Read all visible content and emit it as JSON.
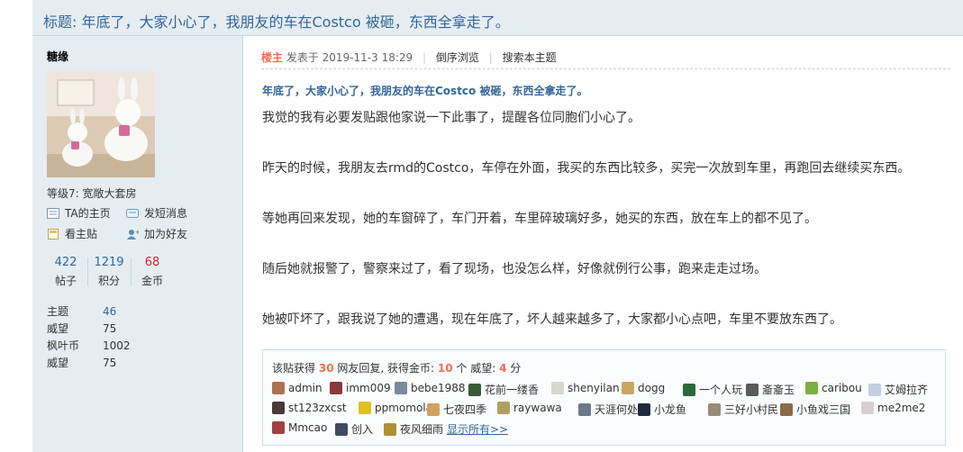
{
  "thread": {
    "title": "标题: 年底了，大家小心了，我朋友的车在Costco 被砸，东西全拿走了。"
  },
  "author": {
    "name": "糖缘",
    "level": "等级7: 宽敞大套房",
    "actions": {
      "profile": "TA的主页",
      "message": "发短消息",
      "view_only": "看主贴",
      "add_friend": "加为好友"
    },
    "stats": [
      {
        "value": "422",
        "label": "帖子",
        "color": "#336699"
      },
      {
        "value": "1219",
        "label": "积分",
        "color": "#336699"
      },
      {
        "value": "68",
        "label": "金币",
        "color": "#e02020"
      }
    ],
    "info": [
      {
        "key": "主题",
        "value": "46"
      },
      {
        "key": "威望",
        "value": "75"
      },
      {
        "key": "枫叶币",
        "value": "1002"
      },
      {
        "key": "威望",
        "value": "75"
      }
    ]
  },
  "post": {
    "op_label": "楼主",
    "posted_at": "发表于 2019-11-3 18:29",
    "reverse_order": "倒序浏览",
    "search_topic": "搜索本主题",
    "subject": "年底了，大家小心了，我朋友的车在Costco 被砸，东西全拿走了。",
    "paragraphs": [
      "我觉的我有必要发贴跟他家说一下此事了，提醒各位同胞们小心了。",
      "昨天的时候，我朋友去rmd的Costco，车停在外面，我买的东西比较多，买完一次放到车里，再跑回去继续买东西。",
      "等她再回来发现，她的车窗碎了，车门开着，车里碎玻璃好多，她买的东西，放在车上的都不见了。",
      "随后她就报警了，警察来过了，看了现场，也没怎么样，好像就例行公事，跑来走走过场。",
      "她被吓坏了，跟我说了她的遭遇，现在年底了，坏人越来越多了，大家都小心点吧，车里不要放东西了。"
    ]
  },
  "rating": {
    "prefix": "该贴获得",
    "replies": "30",
    "replies_suffix": "网友回复, 获得金币:",
    "coins": "10",
    "coins_suffix": "个 威望:",
    "prestige": "4",
    "prestige_suffix": "分",
    "users": [
      {
        "name": "admin",
        "color": "#b07050"
      },
      {
        "name": "imm009",
        "color": "#8a3a3a"
      },
      {
        "name": "bebe1988",
        "color": "#7a8a9a"
      },
      {
        "name": "花前一缕香",
        "color": "#3a5a3a"
      },
      {
        "name": "shenyilan",
        "color": "#d8d8d0"
      },
      {
        "name": "dogg",
        "color": "#c8a860"
      },
      {
        "name": "一个人玩",
        "color": "#2a6a3a"
      },
      {
        "name": "齑齑玉",
        "color": "#5a5a5a"
      },
      {
        "name": "caribou",
        "color": "#7ab040"
      },
      {
        "name": "艾姆拉齐",
        "color": "#c0d0e0"
      },
      {
        "name": "st123zxcst",
        "color": "#4a3a3a"
      },
      {
        "name": "ppmomola",
        "color": "#e0c020"
      },
      {
        "name": "七夜四季",
        "color": "#d0a060"
      },
      {
        "name": "raywawa",
        "color": "#b0a060"
      },
      {
        "name": "天涯何处",
        "color": "#6a7a8a"
      },
      {
        "name": "小龙鱼",
        "color": "#202840"
      },
      {
        "name": "三好小村民",
        "color": "#9a8a7a"
      },
      {
        "name": "小鱼戏三国",
        "color": "#8a6a4a"
      },
      {
        "name": "me2me2",
        "color": "#d8d0d0"
      },
      {
        "name": "Mmcao",
        "color": "#a04040"
      },
      {
        "name": "创入",
        "color": "#404a60"
      },
      {
        "name": "夜风细雨",
        "color": "#b09030"
      }
    ],
    "more": "显示所有>>"
  }
}
